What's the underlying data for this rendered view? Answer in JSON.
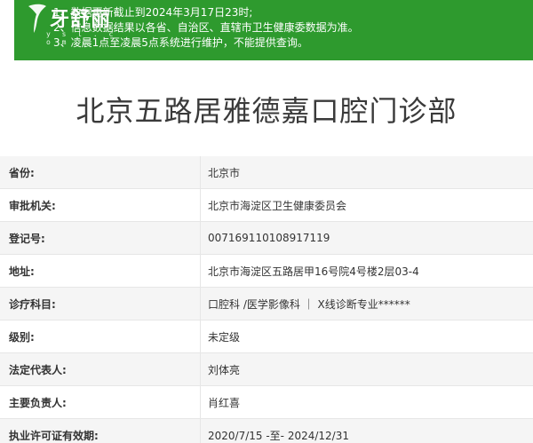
{
  "logo": {
    "brand": "牙舒丽",
    "sub": "y s l . c o m"
  },
  "notice": {
    "lines": [
      "1、数据更新截止到2024年3月17日23时;",
      "2、信息数据结果以各省、自治区、直辖市卫生健康委数据为准。",
      "3、凌晨1点至凌晨5点系统进行维护，不能提供查询。"
    ]
  },
  "clinic": {
    "name": "北京五路居雅德嘉口腔门诊部"
  },
  "fields": [
    {
      "label": "省份:",
      "value": "北京市"
    },
    {
      "label": "审批机关:",
      "value": "北京市海淀区卫生健康委员会"
    },
    {
      "label": "登记号:",
      "value": "007169110108917119"
    },
    {
      "label": "地址:",
      "value": "北京市海淀区五路居甲16号院4号楼2层03-4"
    },
    {
      "label": "诊疗科目:",
      "value": "口腔科 /医学影像科 ｜ X线诊断专业******"
    },
    {
      "label": "级别:",
      "value": "未定级"
    },
    {
      "label": "法定代表人:",
      "value": "刘体亮"
    },
    {
      "label": "主要负责人:",
      "value": "肖红喜"
    },
    {
      "label": "执业许可证有效期:",
      "value": "2020/7/15 -至- 2024/12/31"
    }
  ],
  "colors": {
    "notice_bg": "#2e9a2e",
    "row_alt": "#f5f5f5"
  }
}
